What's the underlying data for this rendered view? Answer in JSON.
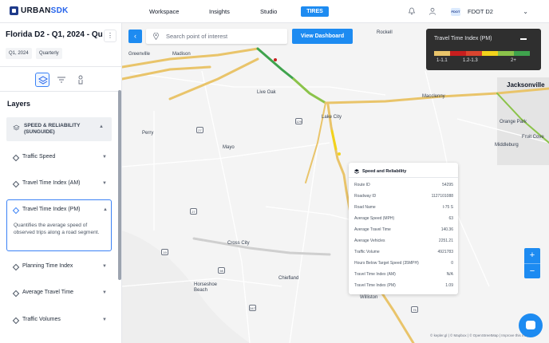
{
  "nav": {
    "logo_a": "URBAN",
    "logo_b": "SDK",
    "items": [
      "Workspace",
      "Insights",
      "Studio"
    ],
    "active": "TIRES",
    "org_badge": "FDOT",
    "org_name": "FDOT D2"
  },
  "sidebar": {
    "title": "Florida D2 - Q1, 2024 - Qu...",
    "chips": [
      "Q1, 2024",
      "Quarterly"
    ],
    "layers_title": "Layers",
    "group_label": "SPEED & RELIABILITY (SUNGUIDE)",
    "layers": [
      "Traffic Speed",
      "Travel Time Index (AM)",
      "Travel Time Index (PM)",
      "Planning Time Index",
      "Average Travel Time",
      "Traffic Volumes"
    ],
    "selected_description": "Quantifies the average speed of observed trips along a road segment."
  },
  "map": {
    "search_placeholder": "Search point of interest",
    "view_dashboard": "View Dashboard",
    "zoom_in": "+",
    "zoom_out": "−",
    "attribution": "© kepler.gl | © Mapbox | © OpenStreetMap | Improve this map",
    "legend": {
      "title": "Travel Time Index (PM)",
      "colors": [
        "#e9c46a",
        "#c81e1e",
        "#d9452f",
        "#f2d31b",
        "#8bc34a",
        "#3fa34d"
      ],
      "labels": [
        "1-1.1",
        "1.2-1.3",
        "2+"
      ]
    },
    "cities": [
      {
        "name": "Greenville"
      },
      {
        "name": "Madison"
      },
      {
        "name": "Live Oak"
      },
      {
        "name": "Lake City"
      },
      {
        "name": "Macclenny"
      },
      {
        "name": "Rockell"
      },
      {
        "name": "Jacksonville"
      },
      {
        "name": "Orange Park"
      },
      {
        "name": "Fruit Cove"
      },
      {
        "name": "Middleburg"
      },
      {
        "name": "Perry"
      },
      {
        "name": "Mayo"
      },
      {
        "name": "Cross City"
      },
      {
        "name": "Chiefland"
      },
      {
        "name": "Horseshoe Beach"
      },
      {
        "name": "Williston"
      }
    ],
    "shields": [
      "10",
      "27",
      "129",
      "27",
      "19",
      "98",
      "347",
      "41",
      "75"
    ],
    "popup": {
      "title": "Speed and Reliability",
      "rows": [
        {
          "k": "Route ID",
          "v": "54295"
        },
        {
          "k": "Roadway ID",
          "v": "1127101088"
        },
        {
          "k": "Road Name",
          "v": "I-75 S"
        },
        {
          "k": "Average Speed (MPH)",
          "v": "63"
        },
        {
          "k": "Average Travel Time",
          "v": "140.36"
        },
        {
          "k": "Average Vehicles",
          "v": "2251.21"
        },
        {
          "k": "Traffic Volume",
          "v": "4921783"
        },
        {
          "k": "Hours Below Target Speed (35MPH)",
          "v": "0"
        },
        {
          "k": "Travel Time Index (AM)",
          "v": "N/A"
        },
        {
          "k": "Travel Time Index (PM)",
          "v": "1.09"
        }
      ]
    }
  }
}
